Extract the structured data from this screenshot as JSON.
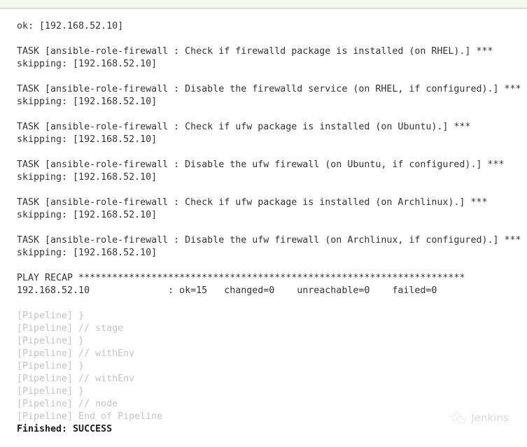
{
  "page": {
    "title": "Jenkins Console Output",
    "background_color": "#ffffff",
    "text_color": "#333333",
    "top_strip_color": "#f5f8f0",
    "top_rule_color": "#dcdcdc"
  },
  "console": {
    "lines": [
      {
        "text": "ok: [192.168.52.10]",
        "style": "normal"
      },
      {
        "text": "",
        "style": "blank"
      },
      {
        "text": "TASK [ansible-role-firewall : Check if firewalld package is installed (on RHEL).] ***",
        "style": "normal"
      },
      {
        "text": "skipping: [192.168.52.10]",
        "style": "normal"
      },
      {
        "text": "",
        "style": "blank"
      },
      {
        "text": "TASK [ansible-role-firewall : Disable the firewalld service (on RHEL, if configured).] ***",
        "style": "normal"
      },
      {
        "text": "skipping: [192.168.52.10]",
        "style": "normal"
      },
      {
        "text": "",
        "style": "blank"
      },
      {
        "text": "TASK [ansible-role-firewall : Check if ufw package is installed (on Ubuntu).] ***",
        "style": "normal"
      },
      {
        "text": "skipping: [192.168.52.10]",
        "style": "normal"
      },
      {
        "text": "",
        "style": "blank"
      },
      {
        "text": "TASK [ansible-role-firewall : Disable the ufw firewall (on Ubuntu, if configured).] ***",
        "style": "normal"
      },
      {
        "text": "skipping: [192.168.52.10]",
        "style": "normal"
      },
      {
        "text": "",
        "style": "blank"
      },
      {
        "text": "TASK [ansible-role-firewall : Check if ufw package is installed (on Archlinux).] ***",
        "style": "normal"
      },
      {
        "text": "skipping: [192.168.52.10]",
        "style": "normal"
      },
      {
        "text": "",
        "style": "blank"
      },
      {
        "text": "TASK [ansible-role-firewall : Disable the ufw firewall (on Archlinux, if configured).] ***",
        "style": "normal"
      },
      {
        "text": "skipping: [192.168.52.10]",
        "style": "normal"
      },
      {
        "text": "",
        "style": "blank"
      },
      {
        "text": "PLAY RECAP *********************************************************************",
        "style": "normal"
      },
      {
        "text": "192.168.52.10              : ok=15   changed=0    unreachable=0    failed=0",
        "style": "normal"
      },
      {
        "text": "",
        "style": "blank"
      },
      {
        "text": "[Pipeline] }",
        "style": "pipeline"
      },
      {
        "text": "[Pipeline] // stage",
        "style": "pipeline"
      },
      {
        "text": "[Pipeline] }",
        "style": "pipeline"
      },
      {
        "text": "[Pipeline] // withEnv",
        "style": "pipeline"
      },
      {
        "text": "[Pipeline] }",
        "style": "pipeline"
      },
      {
        "text": "[Pipeline] // withEnv",
        "style": "pipeline"
      },
      {
        "text": "[Pipeline] }",
        "style": "pipeline"
      },
      {
        "text": "[Pipeline] // node",
        "style": "pipeline"
      },
      {
        "text": "[Pipeline] End of Pipeline",
        "style": "pipeline"
      },
      {
        "text": "Finished: SUCCESS",
        "style": "result"
      }
    ],
    "play_recap": {
      "host": "192.168.52.10",
      "ok": 15,
      "changed": 0,
      "unreachable": 0,
      "failed": 0
    },
    "final_status": "SUCCESS"
  },
  "watermark": {
    "label": "Jenkins",
    "icon": "wechat-icon",
    "color": "#c9c9c9"
  }
}
